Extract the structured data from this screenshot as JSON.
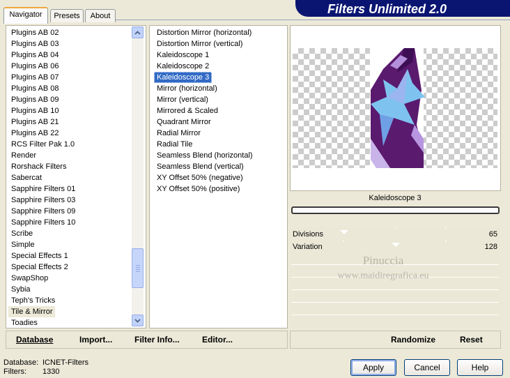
{
  "app": {
    "title": "Filters Unlimited 2.0"
  },
  "tabs": [
    {
      "label": "Navigator",
      "active": true
    },
    {
      "label": "Presets",
      "active": false
    },
    {
      "label": "About",
      "active": false
    }
  ],
  "categories": {
    "items": [
      "Plugins AB 02",
      "Plugins AB 03",
      "Plugins AB 04",
      "Plugins AB 06",
      "Plugins AB 07",
      "Plugins AB 08",
      "Plugins AB 09",
      "Plugins AB 10",
      "Plugins AB 21",
      "Plugins AB 22",
      "RCS Filter Pak 1.0",
      "Render",
      "Rorshack Filters",
      "Sabercat",
      "Sapphire Filters 01",
      "Sapphire Filters 03",
      "Sapphire Filters 09",
      "Sapphire Filters 10",
      "Scribe",
      "Simple",
      "Special Effects 1",
      "Special Effects 2",
      "SwapShop",
      "Sybia",
      "Teph's Tricks",
      "Tile & Mirror",
      "Toadies"
    ],
    "selected": "Tile & Mirror"
  },
  "filters": {
    "items": [
      "Distortion Mirror (horizontal)",
      "Distortion Mirror (vertical)",
      "Kaleidoscope 1",
      "Kaleidoscope 2",
      "Kaleidoscope 3",
      "Mirror (horizontal)",
      "Mirror (vertical)",
      "Mirrored & Scaled",
      "Quadrant Mirror",
      "Radial Mirror",
      "Radial Tile",
      "Seamless Blend (horizontal)",
      "Seamless Blend (vertical)",
      "XY Offset 50% (negative)",
      "XY Offset 50% (positive)"
    ],
    "selected": "Kaleidoscope 3"
  },
  "preview": {
    "filter_name": "Kaleidoscope 3",
    "progress": 0
  },
  "parameters": [
    {
      "label": "Divisions",
      "value": "65"
    },
    {
      "label": "Variation",
      "value": "128"
    }
  ],
  "watermark": {
    "line1": "Pinuccia",
    "line2": "www.maidiregrafica.eu"
  },
  "commands": {
    "database": "Database",
    "import": "Import...",
    "filter_info": "Filter Info...",
    "editor": "Editor...",
    "randomize": "Randomize",
    "reset": "Reset"
  },
  "status": {
    "database_label": "Database:",
    "database_value": "ICNET-Filters",
    "filters_label": "Filters:",
    "filters_value": "1330"
  },
  "buttons": {
    "apply": "Apply",
    "cancel": "Cancel",
    "help": "Help"
  },
  "icons": {
    "scroll_up": "chevron-up-icon",
    "scroll_down": "chevron-down-icon",
    "thumb_grip": "grip-icon"
  },
  "colors": {
    "header_band": "#0a1572",
    "selection": "#316ac5",
    "shape_dark": "#5a1a6e",
    "shape_light": "#7ec3ef"
  }
}
